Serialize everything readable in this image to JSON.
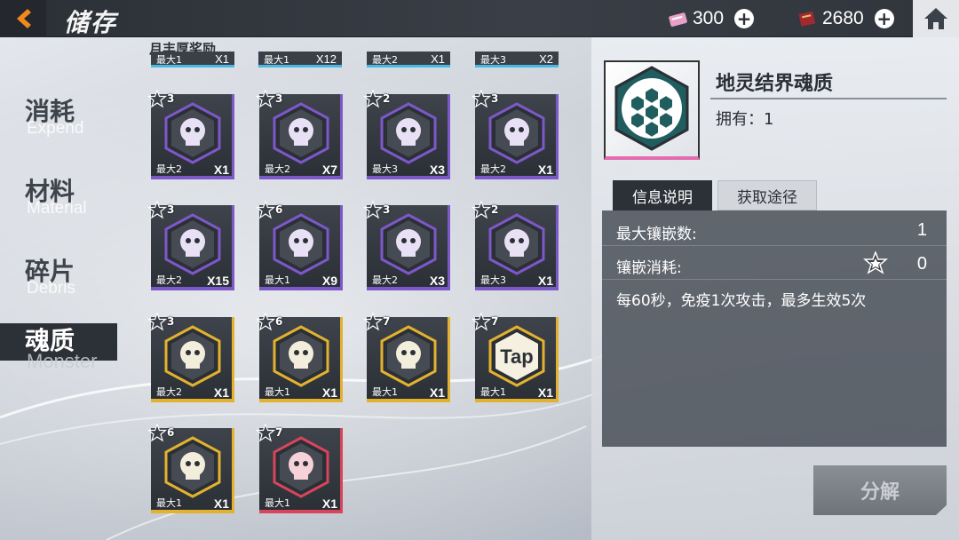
{
  "header": {
    "title": "储存",
    "currency_pink": "300",
    "currency_red": "2680"
  },
  "tabs": [
    {
      "zh": "消耗",
      "en": "Expend"
    },
    {
      "zh": "材料",
      "en": "Material"
    },
    {
      "zh": "碎片",
      "en": "Debris"
    },
    {
      "zh": "魂质",
      "en": "Monster"
    }
  ],
  "grid": {
    "section_label": "月丰厚奖励",
    "top_strips": [
      {
        "max": "最大1",
        "count": "X1"
      },
      {
        "max": "最大1",
        "count": "X12"
      },
      {
        "max": "最大2",
        "count": "X1"
      },
      {
        "max": "最大3",
        "count": "X2"
      }
    ],
    "items": [
      {
        "lvl": "3",
        "max": "最大2",
        "count": "X1",
        "rarity": "purple",
        "icon": "skull-crossed-icon"
      },
      {
        "lvl": "3",
        "max": "最大2",
        "count": "X7",
        "rarity": "purple",
        "icon": "horned-mask-icon"
      },
      {
        "lvl": "2",
        "max": "最大3",
        "count": "X3",
        "rarity": "purple",
        "icon": "fanged-skull-icon"
      },
      {
        "lvl": "3",
        "max": "最大2",
        "count": "X1",
        "rarity": "purple",
        "icon": "tied-skull-icon"
      },
      {
        "lvl": "3",
        "max": "最大2",
        "count": "X15",
        "rarity": "purple",
        "icon": "skull-crossed-icon"
      },
      {
        "lvl": "6",
        "max": "最大1",
        "count": "X9",
        "rarity": "purple",
        "icon": "beast-skull-icon"
      },
      {
        "lvl": "3",
        "max": "最大2",
        "count": "X3",
        "rarity": "purple",
        "icon": "spiral-shell-icon"
      },
      {
        "lvl": "2",
        "max": "最大3",
        "count": "X1",
        "rarity": "purple",
        "icon": "octopus-icon"
      },
      {
        "lvl": "3",
        "max": "最大2",
        "count": "X1",
        "rarity": "gold",
        "icon": "demon-face-icon"
      },
      {
        "lvl": "6",
        "max": "最大1",
        "count": "X1",
        "rarity": "gold",
        "icon": "shield-emblem-icon"
      },
      {
        "lvl": "7",
        "max": "最大1",
        "count": "X1",
        "rarity": "gold",
        "icon": "crown-ring-icon"
      },
      {
        "lvl": "7",
        "max": "最大1",
        "count": "X1",
        "rarity": "gold",
        "icon": "tap-icon",
        "icon_text": "Tap"
      },
      {
        "lvl": "6",
        "max": "最大1",
        "count": "X1",
        "rarity": "gold",
        "icon": "zigzag-face-icon"
      },
      {
        "lvl": "7",
        "max": "最大1",
        "count": "X1",
        "rarity": "red",
        "icon": "red-creature-icon"
      }
    ]
  },
  "detail": {
    "name": "地灵结界魂质",
    "owned": "拥有：1",
    "tab_info": "信息说明",
    "tab_source": "获取途径",
    "max_inlay_label": "最大镶嵌数:",
    "max_inlay_value": "1",
    "inlay_cost_label": "镶嵌消耗:",
    "inlay_cost_value": "0",
    "description": "每60秒，免疫1次攻击，最多生效5次",
    "decompose": "分解"
  },
  "colors": {
    "purple_rarity": "#7d58c9",
    "gold_rarity": "#e2b22f",
    "red_rarity": "#d6455b",
    "accent_orange": "#f08a1e"
  }
}
